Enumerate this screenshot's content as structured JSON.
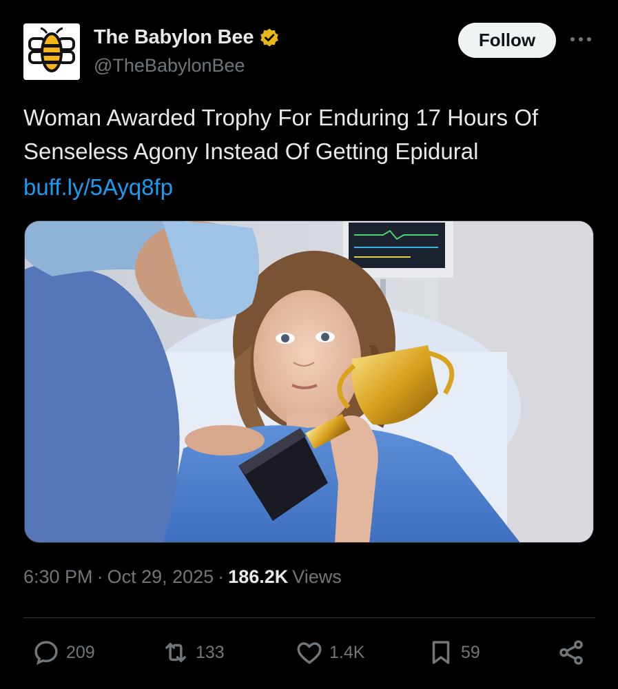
{
  "author": {
    "display_name": "The Babylon Bee",
    "handle": "@TheBabylonBee",
    "avatar_icon": "babylon-bee-logo",
    "verified_icon": "gold-verified-badge-icon",
    "verified_color": "#e8b51a"
  },
  "header": {
    "follow_label": "Follow",
    "more_icon": "more-dots-icon"
  },
  "post": {
    "text": "Woman Awarded Trophy For Enduring 17 Hours Of Senseless Agony Instead Of Getting Epidural",
    "link": "buff.ly/5Ayq8fp",
    "image_icon": "hospital-patient-trophy-photo"
  },
  "meta": {
    "time": "6:30 PM",
    "date": "Oct 29, 2025",
    "views_count": "186.2K",
    "views_label": "Views",
    "separator": "·"
  },
  "actions": {
    "replies": "209",
    "reposts": "133",
    "likes": "1.4K",
    "bookmarks": "59"
  },
  "colors": {
    "background": "#000000",
    "text_primary": "#e7e9ea",
    "text_secondary": "#71767b",
    "link": "#1d9bf0",
    "divider": "#2f3336"
  }
}
